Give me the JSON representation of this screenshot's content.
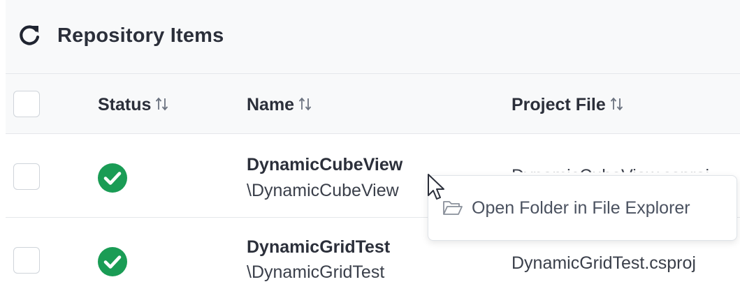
{
  "header": {
    "title": "Repository Items",
    "refresh_icon": "refresh-icon"
  },
  "columns": {
    "status": "Status",
    "name": "Name",
    "project_file": "Project File",
    "sort_icon": "sort-arrows-icon"
  },
  "rows": [
    {
      "status": "ok",
      "name": "DynamicCubeView",
      "path": "\\DynamicCubeView",
      "project_file": "DynamicCubeView.csproj"
    },
    {
      "status": "ok",
      "name": "DynamicGridTest",
      "path": "\\DynamicGridTest",
      "project_file": "DynamicGridTest.csproj"
    }
  ],
  "context_menu": {
    "items": [
      {
        "label": "Open Folder in File Explorer",
        "icon": "folder-open-icon"
      }
    ]
  },
  "colors": {
    "status_ok": "#1a9c55",
    "header_bg": "#f8f9fa",
    "border": "#e5e7eb"
  }
}
